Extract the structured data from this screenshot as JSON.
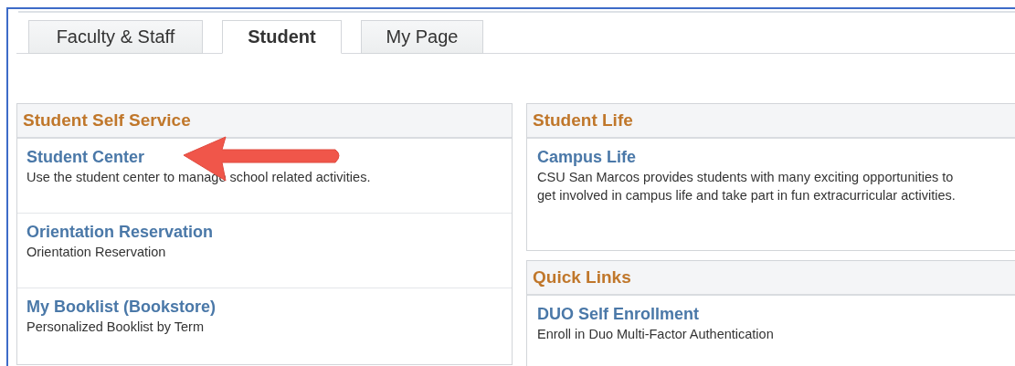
{
  "tabs": [
    {
      "label": "Faculty & Staff",
      "selected": false
    },
    {
      "label": "Student",
      "selected": true
    },
    {
      "label": "My Page",
      "selected": false
    }
  ],
  "columns": [
    [
      {
        "title": "Student Self Service",
        "items": [
          {
            "link": "Student Center",
            "description": "Use the student center to manage school related activities.",
            "pointed": true
          },
          {
            "link": "Orientation Reservation",
            "description": "Orientation Reservation",
            "pointed": false
          },
          {
            "link": "My Booklist (Bookstore)",
            "description": "Personalized Booklist by Term",
            "pointed": false
          }
        ]
      }
    ],
    [
      {
        "title": "Student Life",
        "items": [
          {
            "link": "Campus Life",
            "description": "CSU San Marcos provides students with many exciting opportunities to get involved in campus life and take part in fun extracurricular activities.",
            "pointed": false
          }
        ]
      },
      {
        "title": "Quick Links",
        "items": [
          {
            "link": "DUO Self Enrollment",
            "description": "Enroll in Duo Multi-Factor Authentication",
            "pointed": false
          }
        ]
      }
    ]
  ]
}
